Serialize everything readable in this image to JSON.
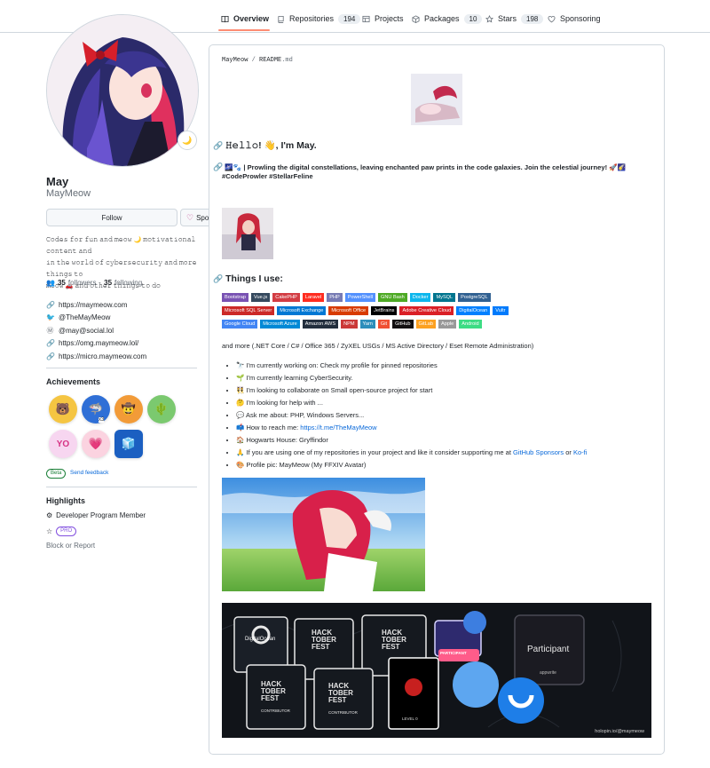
{
  "nav": {
    "tabs": [
      {
        "label": "Overview",
        "icon": "book-icon",
        "count": ""
      },
      {
        "label": "Repositories",
        "icon": "repo-icon",
        "count": "194"
      },
      {
        "label": "Projects",
        "icon": "table-icon",
        "count": ""
      },
      {
        "label": "Packages",
        "icon": "package-icon",
        "count": "10"
      },
      {
        "label": "Stars",
        "icon": "star-icon",
        "count": "198"
      },
      {
        "label": "Sponsoring",
        "icon": "heart-icon",
        "count": ""
      }
    ]
  },
  "profile": {
    "status_emoji": "🌙",
    "name": "May",
    "login": "MayMeow",
    "follow_label": "Follow",
    "sponsor_label": "Sponsor",
    "bio_lines": [
      "𝙲𝚘𝚍𝚎𝚜 𝚏𝚘𝚛 𝚏𝚞𝚗 𝚊𝚗𝚍 𝚖𝚎𝚘𝚠 🌙 𝚖𝚘𝚝𝚒𝚟𝚊𝚝𝚒𝚘𝚗𝚊𝚕 𝚌𝚘𝚗𝚝𝚎𝚗𝚝 𝚊𝚗𝚍",
      "𝚒𝚗 𝚝𝚑𝚎 𝚠𝚘𝚛𝚕𝚍 𝚘𝚏 𝚌𝚢𝚋𝚎𝚛𝚜𝚎𝚌𝚞𝚛𝚒𝚝𝚢 𝚊𝚗𝚍 𝚖𝚘𝚛𝚎 𝚝𝚑𝚒𝚗𝚐𝚜 𝚝𝚘",
      "𝚖𝚎𝚘𝚠 🚗 𝚊𝚗𝚍 𝚘𝚝𝚑𝚎𝚛 𝚝𝚑𝚒𝚗𝚐𝚜 𝚝𝚘 𝚍𝚘"
    ],
    "followers_count": "35",
    "followers_label": "followers",
    "following_count": "35",
    "following_label": "following",
    "links": [
      {
        "icon": "link-icon",
        "text": "https://maymeow.com"
      },
      {
        "icon": "twitter-icon",
        "text": "@TheMayMeow"
      },
      {
        "icon": "mastodon-icon",
        "text": "@may@social.lol"
      },
      {
        "icon": "link-icon",
        "text": "https://omg.maymeow.lol/"
      },
      {
        "icon": "link-icon",
        "text": "https://micro.maymeow.com"
      }
    ],
    "achievements_title": "Achievements",
    "achievement_multiplier": "x3",
    "beta_label": "Beta",
    "feedback_label": "Send feedback",
    "highlights_title": "Highlights",
    "highlight_member": "Developer Program Member",
    "pro_label": "PRO",
    "block_label": "Block or Report"
  },
  "readme": {
    "owner": "MayMeow",
    "separator": " / ",
    "file": "README",
    "ext": ".md",
    "greeting": "𝙷𝚎𝚕𝚕𝚘! 👋, I'm May.",
    "tagline": "🌌🐾 | Prowling the digital constellations, leaving enchanted paw prints in the code galaxies. Join the celestial journey! 🚀🌠",
    "hashtags": "#CodeProwler #StellarFeline",
    "things_title": "Things I use:",
    "badges": [
      [
        {
          "label": "Bootstrap",
          "color": "#7952b3"
        },
        {
          "label": "Vue.js",
          "color": "#35495e"
        },
        {
          "label": "CakePHP",
          "color": "#d33c43"
        },
        {
          "label": "Laravel",
          "color": "#ff2d20"
        },
        {
          "label": "PHP",
          "color": "#777bb4"
        },
        {
          "label": "PowerShell",
          "color": "#5391fe"
        },
        {
          "label": "GNU Bash",
          "color": "#4eaa25"
        },
        {
          "label": "Docker",
          "color": "#0db7ed"
        },
        {
          "label": "MySQL",
          "color": "#00758f"
        },
        {
          "label": "PostgreSQL",
          "color": "#316192"
        }
      ],
      [
        {
          "label": "Microsoft SQL Server",
          "color": "#cc2927"
        },
        {
          "label": "Microsoft Exchange",
          "color": "#0078d4"
        },
        {
          "label": "Microsoft Office",
          "color": "#d83b01"
        },
        {
          "label": "JetBrains",
          "color": "#000000"
        },
        {
          "label": "Adobe Creative Cloud",
          "color": "#da1f26"
        },
        {
          "label": "DigitalOcean",
          "color": "#0080ff"
        },
        {
          "label": "Vultr",
          "color": "#007bfc"
        }
      ],
      [
        {
          "label": "Google Cloud",
          "color": "#4285f4"
        },
        {
          "label": "Microsoft Azure",
          "color": "#0089d6"
        },
        {
          "label": "Amazon AWS",
          "color": "#232f3e"
        },
        {
          "label": "NPM",
          "color": "#cb3837"
        },
        {
          "label": "Yarn",
          "color": "#2c8ebb"
        },
        {
          "label": "Git",
          "color": "#f05033"
        },
        {
          "label": "GitHub",
          "color": "#121011"
        },
        {
          "label": "GitLab",
          "color": "#fca121"
        },
        {
          "label": "Apple",
          "color": "#999999"
        },
        {
          "label": "Android",
          "color": "#3ddc84"
        }
      ]
    ],
    "tech_line": "and more (.NET Core / C# / Office 365 / ZyXEL USGs / MS Active Directory / Eset Remote Administration)",
    "bullets": [
      {
        "emoji": "🔭",
        "text": "I'm currently working on: Check my profile for pinned repositories"
      },
      {
        "emoji": "🌱",
        "text": "I'm currently learning CyberSecurity."
      },
      {
        "emoji": "👯",
        "text": "I'm looking to collaborate on Small open-source project for start"
      },
      {
        "emoji": "🤔",
        "text": "I'm looking for help with ..."
      },
      {
        "emoji": "💬",
        "text": "Ask me about: PHP, Windows Servers..."
      },
      {
        "emoji": "📫",
        "text": "How to reach me: ",
        "link": "https://t.me/TheMayMeow"
      },
      {
        "emoji": "🏠",
        "text": "Hogwarts House: Gryffindor"
      },
      {
        "emoji": "🙏",
        "text": "If you are using one of my repositories in your project and like it consider supporting me at ",
        "link": "GitHub Sponsors",
        "mid": " or ",
        "link2": "Ko-fi"
      },
      {
        "emoji": "🎨",
        "text": "Profile pic: MayMeow (My FFXIV Avatar)"
      }
    ],
    "holopin": {
      "card_digitalocean": "DigitalOcean",
      "card_hack": "HACK",
      "card_tober": "TOBER",
      "card_fest": "FEST",
      "card_contributor": "CONTRIBUTOR",
      "card_level": "LEVEL 0",
      "card_participant": "Participant",
      "card_participant_sub": "appwrite",
      "card_participant_tag": "PARTICIPANT",
      "footer": "holopin.io/@maymeow"
    }
  }
}
